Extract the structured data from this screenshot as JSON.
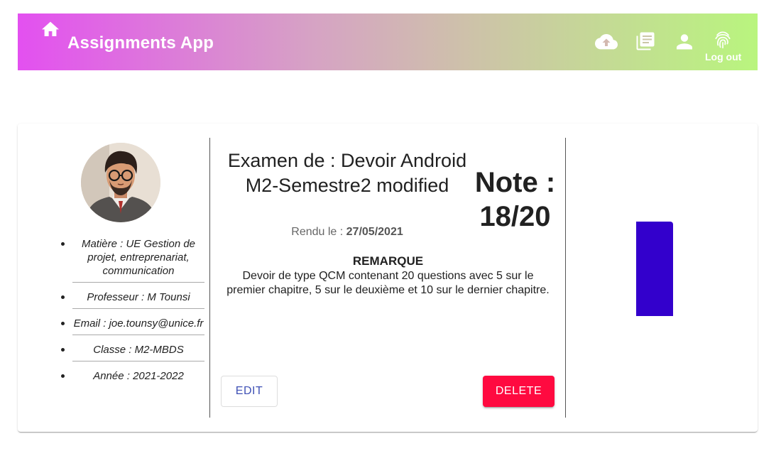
{
  "header": {
    "title": "Assignments App",
    "logout_label": "Log out",
    "icons": [
      "home-icon",
      "cloud-upload-icon",
      "library-books-icon",
      "person-icon",
      "fingerprint-icon"
    ],
    "gradient_start": "#e350f0",
    "gradient_end": "#b9f57e"
  },
  "student": {
    "avatar": "avatar",
    "matiere": "Matière : UE Gestion de projet, entreprenariat, communication",
    "professeur": "Professeur : M Tounsi",
    "email": "Email : joe.tounsy@unice.fr",
    "classe": "Classe : M2-MBDS",
    "annee": "Année : 2021-2022"
  },
  "assignment": {
    "title": "Examen de : Devoir Android M2-Semestre2 modified",
    "rendu_label": "Rendu le :",
    "rendu_date": "27/05/2021",
    "note": "Note : 18/20",
    "remarque_heading": "REMARQUE",
    "remarque_text": "Devoir de type QCM contenant 20 questions avec 5 sur le premier chapitre, 5 sur le deuxième et 10 sur le dernier chapitre."
  },
  "actions": {
    "edit_label": "EDIT",
    "delete_label": "DELETE",
    "edit_color": "#3f51b5",
    "delete_color": "#ff0a40"
  },
  "visual": {
    "bar_color": "#3300cc"
  }
}
